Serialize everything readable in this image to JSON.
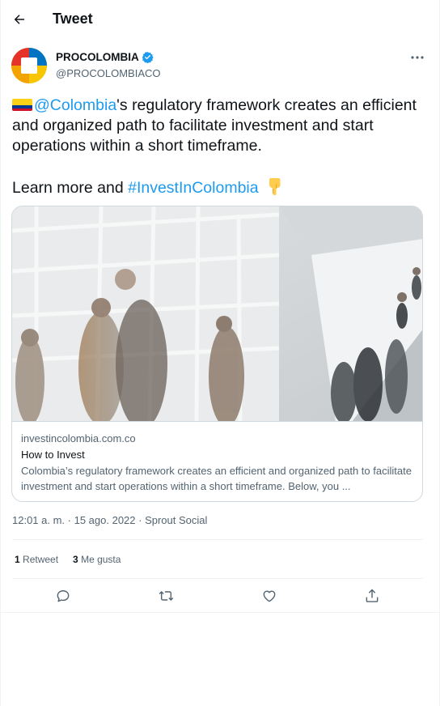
{
  "header": {
    "title": "Tweet",
    "back_icon": "arrow-left-icon"
  },
  "author": {
    "display_name": "PROCOLOMBIA",
    "handle": "@PROCOLOMBIACO",
    "verified": true,
    "avatar_colors": [
      "#f7c600",
      "#e5332a",
      "#0073c2",
      "#ffffff"
    ]
  },
  "tweet": {
    "flag_emoji": "🇨🇴",
    "mention": "@Colombia",
    "line1_rest": "'s regulatory framework creates an efficient and organized path to facilitate investment and start operations within a short timeframe.",
    "line2_prefix": "Learn more and ",
    "hashtag": "#InvestInColombia",
    "emoji_end": "👇"
  },
  "card": {
    "domain": "investincolombia.com.co",
    "title": "How to Invest",
    "description": "Colombia’s regulatory framework creates an efficient and organized path to facilitate investment and start operations within a short timeframe. Below, you ..."
  },
  "meta": {
    "time": "12:01 a. m.",
    "separator": " · ",
    "date": "15 ago. 2022",
    "source": "Sprout Social"
  },
  "stats": {
    "retweets_count": "1",
    "retweets_label": " Retweet",
    "likes_count": "3",
    "likes_label": " Me gusta"
  },
  "actions": [
    "reply-icon",
    "retweet-icon",
    "like-icon",
    "share-icon"
  ],
  "colors": {
    "accent": "#1d9bf0",
    "text": "#0f1419",
    "secondary": "#536471",
    "border": "#cfd9de"
  }
}
